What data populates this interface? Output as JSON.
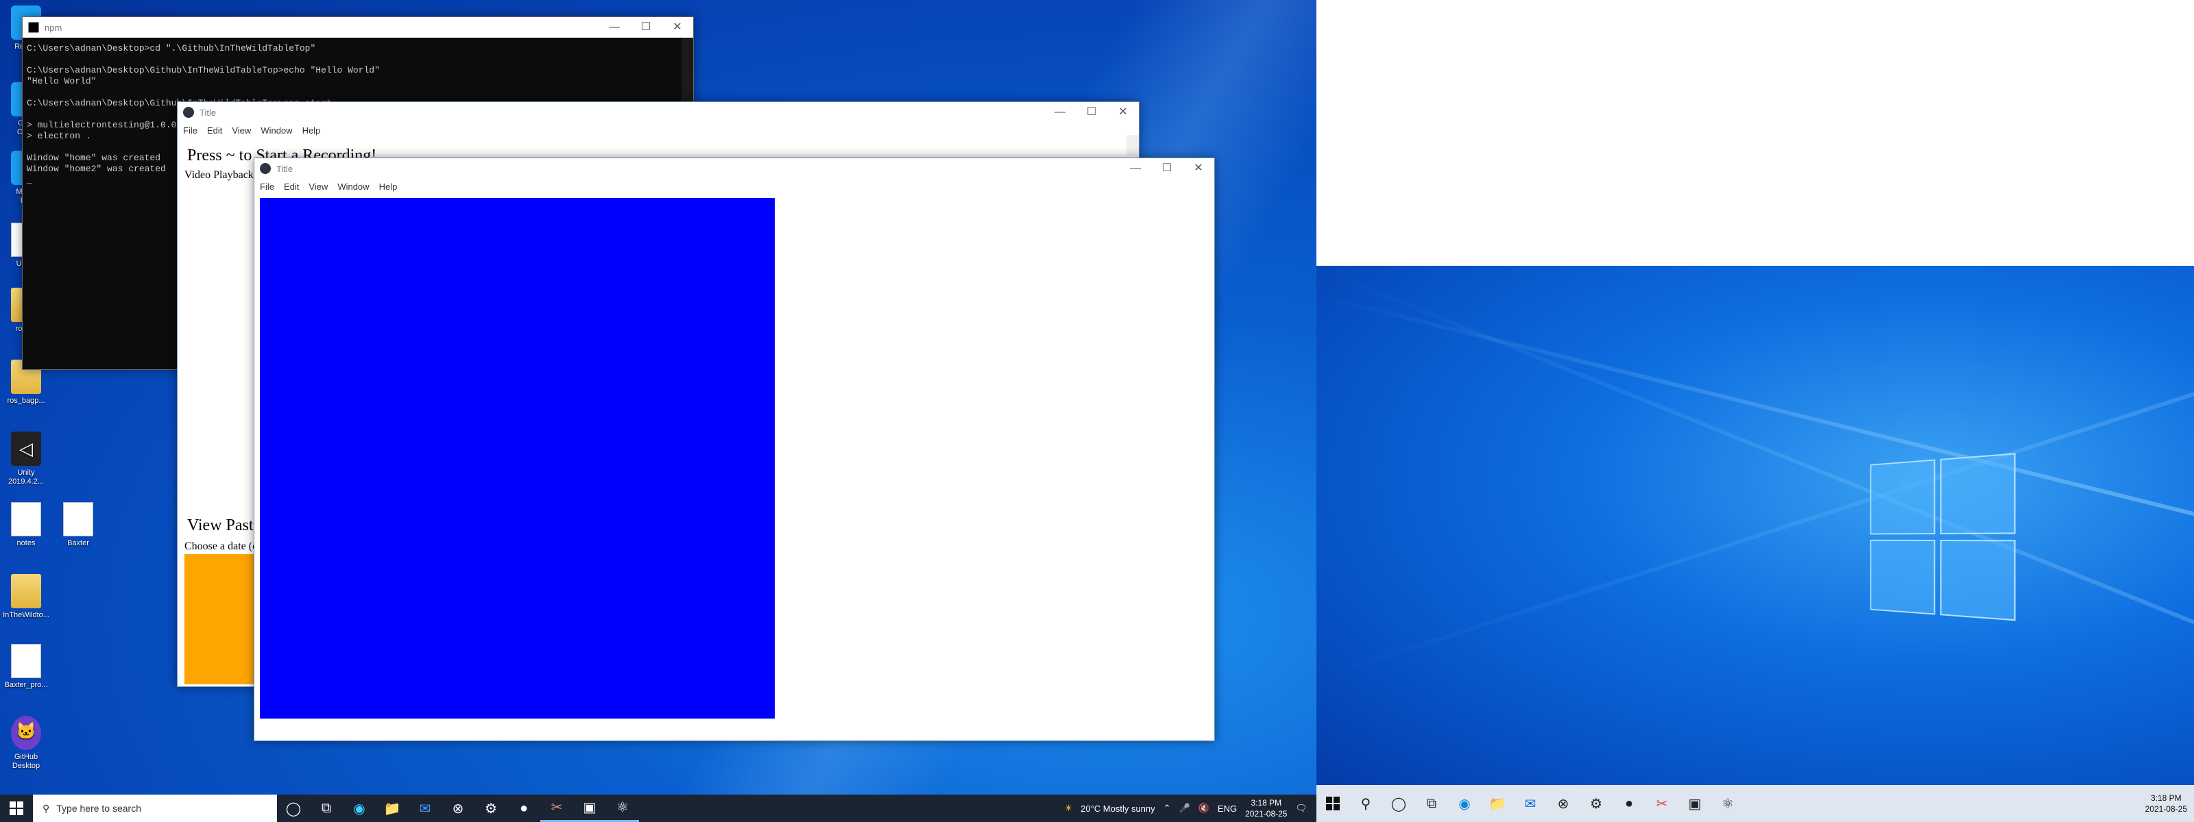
{
  "desktop_icons": [
    {
      "label": "Recy...",
      "kind": "blue"
    },
    {
      "label": "Go...\nChr...",
      "kind": "blue"
    },
    {
      "label": "Micr...\nE...",
      "kind": "blue"
    },
    {
      "label": "Unc...",
      "kind": "file"
    },
    {
      "label": "ros_...",
      "kind": "folder"
    },
    {
      "label": "ros_bagp...",
      "kind": "folder"
    },
    {
      "label": "Unity\n2019.4.2...",
      "kind": "unity"
    },
    {
      "label": "notes",
      "kind": "file"
    },
    {
      "label": "Baxter",
      "kind": "file"
    },
    {
      "label": "InTheWildto...",
      "kind": "folder"
    },
    {
      "label": "Baxter_pro...",
      "kind": "file"
    },
    {
      "label": "GitHub\nDesktop",
      "kind": "github"
    }
  ],
  "terminal": {
    "title": "npm",
    "lines": "C:\\Users\\adnan\\Desktop>cd \".\\Github\\InTheWildTableTop\"\n\nC:\\Users\\adnan\\Desktop\\Github\\InTheWildTableTop>echo \"Hello World\"\n\"Hello World\"\n\nC:\\Users\\adnan\\Desktop\\Github\\InTheWildTableTop>npm start\n\n> multielectrontesting@1.0.0 start\n> electron .\n\nWindow \"home\" was created\nWindow \"home2\" was created\n_"
  },
  "window1": {
    "title": "Title",
    "menu": [
      "File",
      "Edit",
      "View",
      "Window",
      "Help"
    ],
    "heading": "Press ~ to Start a Recording!",
    "video_playback": "Video Playback",
    "view_past": "View Past",
    "choose_date": "Choose a date (c",
    "orange": "#ffa500"
  },
  "window2": {
    "title": "Title",
    "menu": [
      "File",
      "Edit",
      "View",
      "Window",
      "Help"
    ],
    "blue": "#0000ff"
  },
  "window_controls": {
    "minimize": "—",
    "maximize": "☐",
    "close": "✕"
  },
  "taskbar_left": {
    "search_placeholder": "Type here to search",
    "weather": "20°C  Mostly sunny",
    "lang": "ENG",
    "time": "3:18 PM",
    "date": "2021-08-25"
  },
  "taskbar_right": {
    "time": "3:18 PM",
    "date": "2021-08-25"
  }
}
